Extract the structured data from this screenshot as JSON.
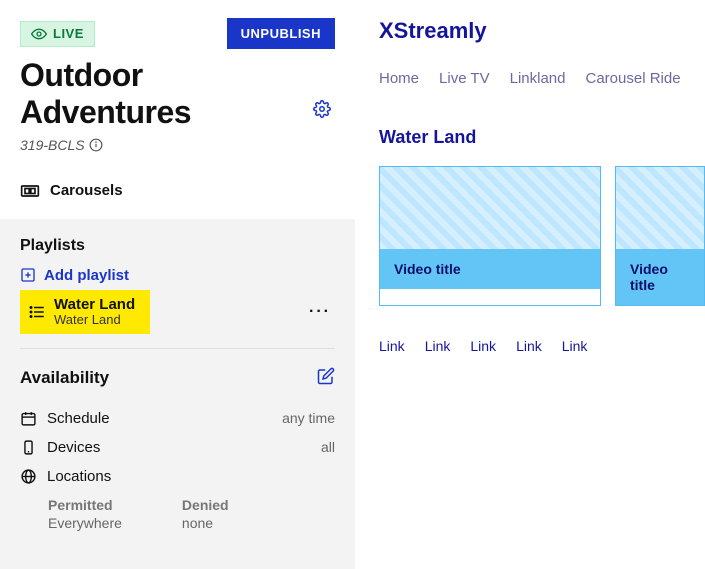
{
  "header": {
    "live_badge": "LIVE",
    "unpublish_label": "UNPUBLISH",
    "title": "Outdoor Adventures",
    "sub_id": "319-BCLS"
  },
  "sections": {
    "carousels_label": "Carousels"
  },
  "playlists": {
    "heading": "Playlists",
    "add_label": "Add playlist",
    "items": [
      {
        "name": "Water Land",
        "sub": "Water Land"
      }
    ]
  },
  "availability": {
    "heading": "Availability",
    "schedule_label": "Schedule",
    "schedule_value": "any time",
    "devices_label": "Devices",
    "devices_value": "all",
    "locations_label": "Locations",
    "permitted_label": "Permitted",
    "permitted_value": "Everywhere",
    "denied_label": "Denied",
    "denied_value": "none"
  },
  "preview": {
    "brand": "XStreamly",
    "tabs": [
      "Home",
      "Live TV",
      "Linkland",
      "Carousel Ride"
    ],
    "carousel_title": "Water Land",
    "card_title": "Video title",
    "links": [
      "Link",
      "Link",
      "Link",
      "Link",
      "Link"
    ]
  }
}
